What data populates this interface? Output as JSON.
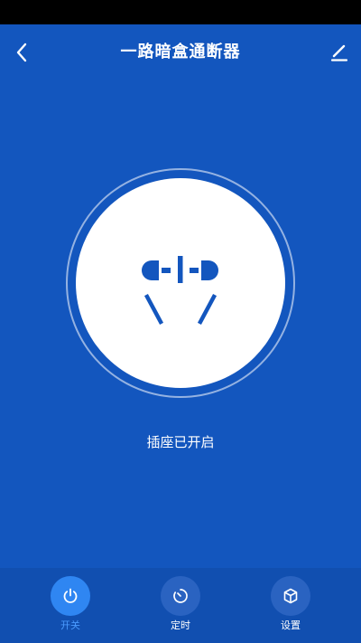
{
  "header": {
    "title": "一路暗盒通断器",
    "back_icon": "back-chevron-icon",
    "edit_icon": "edit-pencil-icon"
  },
  "socket": {
    "icon": "power-socket-icon",
    "status": "插座已开启"
  },
  "tabs": [
    {
      "label": "开关",
      "icon": "power-icon",
      "active": true
    },
    {
      "label": "定时",
      "icon": "timer-icon",
      "active": false
    },
    {
      "label": "设置",
      "icon": "settings-cube-icon",
      "active": false
    }
  ],
  "colors": {
    "background": "#1356BE",
    "tabbar": "#114FB0",
    "active_tab": "#2F86F2",
    "inactive_tab": "#2A63C1",
    "active_label": "#4A9BFF",
    "inactive_label": "#FFFFFF",
    "socket_face": "#FFFFFF",
    "socket_pins": "#1356BE"
  }
}
